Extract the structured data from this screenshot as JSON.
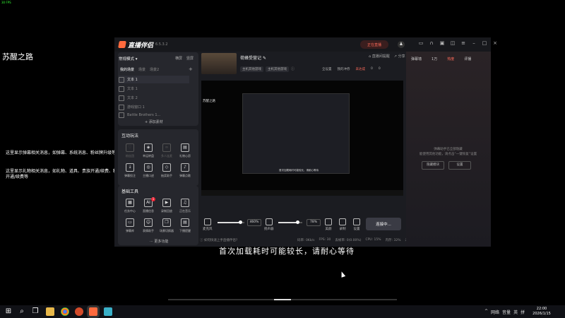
{
  "fps": "30 FPS",
  "desktop": {
    "title": "苏醒之路",
    "note1": "这里显示弹幕相关消息，如弹幕、系统消息、粉丝牌升级等",
    "note2a": "这里显示礼物相关消息，如礼物、道具、贵族开通/续费、粉丝",
    "note2b": "开通/续费等",
    "subtitle": "首次加载耗时可能较长，请耐心等待"
  },
  "app": {
    "name": "直播伴侣",
    "version": "6.5.3.2",
    "live_badge": "正在直播",
    "mode": "常规模式",
    "mode_links": [
      "横屏",
      "竖屏"
    ],
    "source_tabs": [
      "我的场景",
      "场景",
      "场景2"
    ],
    "sources": [
      "文本 1",
      "文本 1",
      "文本 2",
      "游戏窗口 1",
      "Battle Brothers 1..."
    ],
    "add_source": "添加素材",
    "interactive_title": "互动玩法",
    "interactive_tools": [
      "粉丝团",
      "幸运转盘",
      "多人连麦",
      "礼物心愿",
      "弹幕投注",
      "主播口述",
      "抽奖助手",
      "弹幕点歌"
    ],
    "basic_title": "基础工具",
    "basic_tools": [
      "任务中心",
      "直播信息",
      "录制回放",
      "正在音乐",
      "弹幕库",
      "表情助手",
      "场景切换器",
      "下播提醒"
    ],
    "badge_count": "1",
    "more": "更多功能",
    "room_title": "荷蜂受营记",
    "room_tags": [
      "主机其他游戏",
      "主机其他游戏"
    ],
    "header_links": [
      "直播间提醒",
      "分享"
    ],
    "header_row2": [
      "全设置",
      "我的冲券",
      "未达成",
      "0",
      "0"
    ],
    "preview_inner_text": "苏醒之路",
    "preview_caption": "首次加载耗时可能较长，请耐心等待",
    "controls": {
      "mic_label": "麦克风",
      "mic_volume": "460%",
      "mic_level": 0.85,
      "speaker_label": "扬声器",
      "speaker_volume": "78%",
      "speaker_level": 0.78,
      "beauty": "美颜",
      "record": "录制",
      "settings": "设置"
    },
    "live_button": "连接中...",
    "status": {
      "notice": "如何快速上手直播伴侣?",
      "items": [
        "码率: 0Kb/s",
        "FPS: 30",
        "丢帧率: 0(0.00%)",
        "CPU: 15%",
        "内存: 32%",
        "未开播"
      ]
    },
    "right_panel": {
      "tabs": [
        "弹幕墙",
        "1万",
        "热度",
        "评播"
      ],
      "hint_line1": "弹幕助手已全部隐藏",
      "hint_line2": "能使用其他功能，请点击“一键恢复”设置",
      "btn_hide": "隐藏模块",
      "btn_settings": "设置"
    }
  },
  "taskbar": {
    "tray_icons": [
      "^",
      "网络",
      "音量",
      "英",
      "拼"
    ],
    "time": "22:00",
    "date": "2026/1/15"
  }
}
